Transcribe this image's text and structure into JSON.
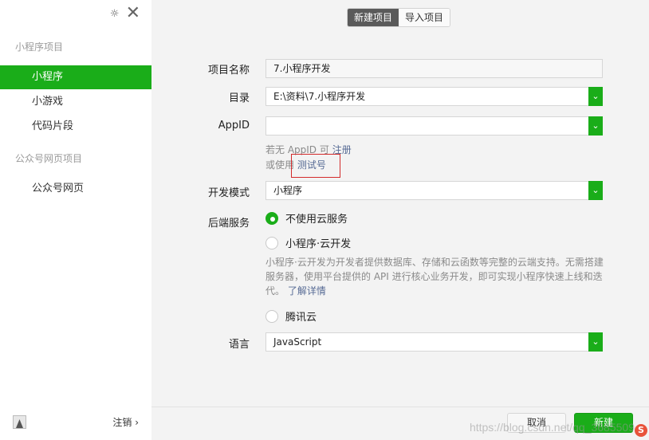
{
  "sidebar": {
    "section_mini": "小程序项目",
    "items_mini": [
      "小程序",
      "小游戏",
      "代码片段"
    ],
    "section_mp": "公众号网页项目",
    "items_mp": [
      "公众号网页"
    ],
    "logout": "注销 ›"
  },
  "tabs": [
    "新建项目",
    "导入项目"
  ],
  "form": {
    "name_label": "项目名称",
    "name_value": "7.小程序开发",
    "dir_label": "目录",
    "dir_value": "E:\\资料\\7.小程序开发",
    "appid_label": "AppID",
    "appid_value": "",
    "hint_no_appid": "若无 AppID 可",
    "hint_register": "注册",
    "hint_or_use": "或使用",
    "hint_test": "测试号",
    "mode_label": "开发模式",
    "mode_value": "小程序",
    "backend_label": "后端服务",
    "backend_options": [
      "不使用云服务",
      "小程序·云开发",
      "腾讯云"
    ],
    "backend_selected": 0,
    "cloud_desc": "小程序·云开发为开发者提供数据库、存储和云函数等完整的云端支持。无需搭建服务器，使用平台提供的 API 进行核心业务开发，即可实现小程序快速上线和迭代。",
    "cloud_more": "了解详情",
    "lang_label": "语言",
    "lang_value": "JavaScript"
  },
  "buttons": {
    "cancel": "取消",
    "create": "新建"
  },
  "watermark": "https://blog.csdn.net/qq_3685509",
  "colors": {
    "accent": "#1aad19",
    "link": "#576b95",
    "highlight": "#d32a2a"
  }
}
